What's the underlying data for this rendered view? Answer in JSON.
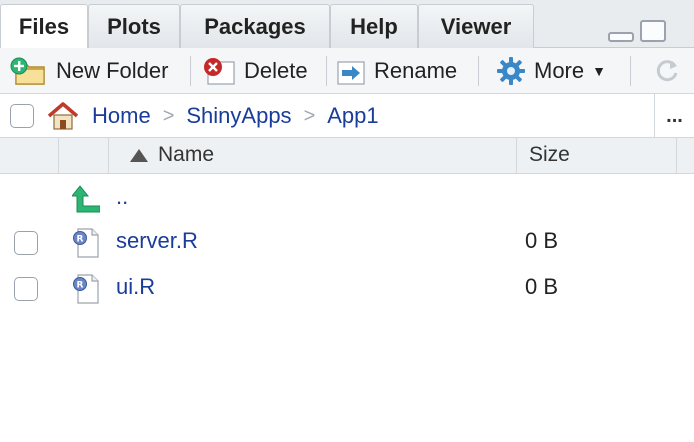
{
  "tabs": [
    {
      "label": "Files",
      "active": true
    },
    {
      "label": "Plots",
      "active": false
    },
    {
      "label": "Packages",
      "active": false
    },
    {
      "label": "Help",
      "active": false
    },
    {
      "label": "Viewer",
      "active": false
    }
  ],
  "toolbar": {
    "new_folder": "New Folder",
    "delete": "Delete",
    "rename": "Rename",
    "more": "More"
  },
  "breadcrumb": {
    "items": [
      "Home",
      "ShinyApps",
      "App1"
    ],
    "more": "..."
  },
  "columns": {
    "name": "Name",
    "size": "Size"
  },
  "files": [
    {
      "name": "..",
      "size": "",
      "type": "parent"
    },
    {
      "name": "server.R",
      "size": "0 B",
      "type": "r-file"
    },
    {
      "name": "ui.R",
      "size": "0 B",
      "type": "r-file"
    }
  ],
  "colors": {
    "link": "#1a3c9a",
    "home_roof": "#c0392b",
    "delete_red": "#c62828",
    "gear_blue": "#3a87c8",
    "green_arrow": "#2bb673"
  }
}
